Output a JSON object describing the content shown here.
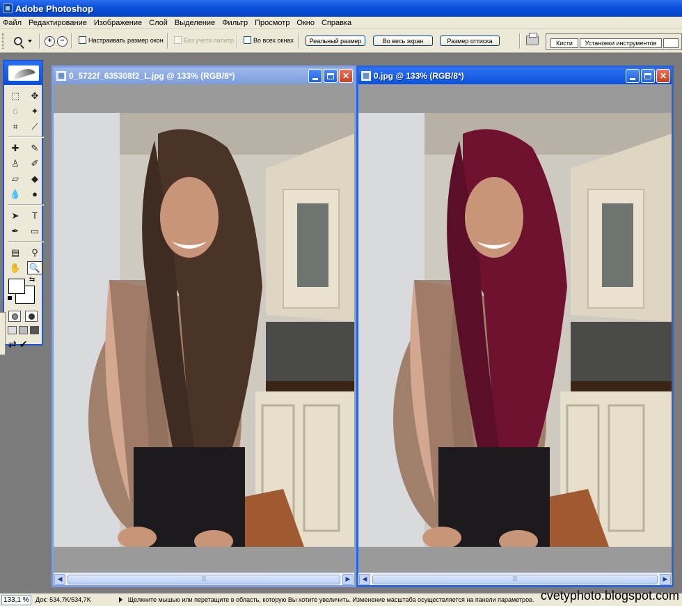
{
  "window": {
    "title": "Adobe Photoshop"
  },
  "menu": [
    "Файл",
    "Редактирование",
    "Изображение",
    "Слой",
    "Выделение",
    "Фильтр",
    "Просмотр",
    "Окно",
    "Справка"
  ],
  "options": {
    "resize_windows": "Настраивать размер окон",
    "ignore_palettes": "Без учета палитр",
    "all_windows": "Во всех окнах",
    "actual_pixels": "Реальный размер",
    "fit_screen": "Во весь экран",
    "print_size": "Размер оттиска"
  },
  "palette_well": {
    "tab_brushes": "Кисти",
    "tab_presets": "Установки инструментов"
  },
  "documents": [
    {
      "title": "0_5722f_635308f2_L.jpg @ 133% (RGB/8*)",
      "hair_color": "#4a3428"
    },
    {
      "title": "0.jpg @ 133% (RGB/8*)",
      "hair_color": "#6e1230"
    }
  ],
  "status": {
    "zoom": "133,1 %",
    "doc_info": "Док: 534,7K/534,7K",
    "hint": "Щелкните мышью или перетащите в область, которую Вы хотите увеличить. Изменение масштаба осуществляется на панели параметров."
  },
  "watermark": "cvetyphoto.blogspot.com"
}
